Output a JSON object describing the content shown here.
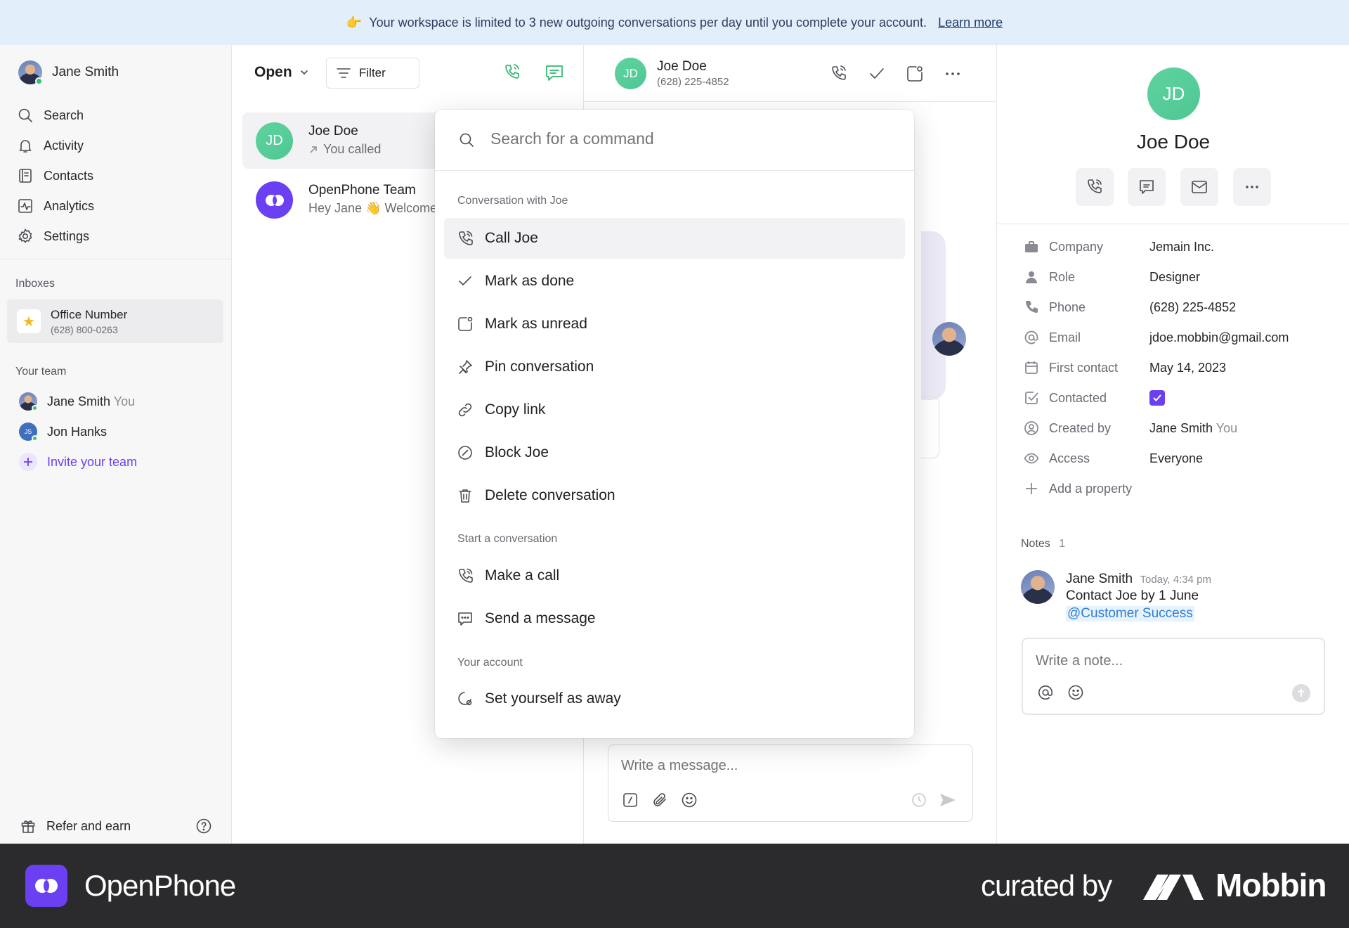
{
  "banner": {
    "emoji": "👉",
    "text": "Your workspace is limited to 3 new outgoing conversations per day until you complete your account.",
    "link": "Learn more"
  },
  "sidebar": {
    "user_name": "Jane Smith",
    "nav": [
      "Search",
      "Activity",
      "Contacts",
      "Analytics",
      "Settings"
    ],
    "inboxes_label": "Inboxes",
    "inbox": {
      "name": "Office Number",
      "number": "(628) 800-0263"
    },
    "team_label": "Your team",
    "team": [
      {
        "name": "Jane Smith",
        "tag": "You"
      },
      {
        "name": "Jon Hanks",
        "tag": "",
        "initials": "JS"
      }
    ],
    "invite": "Invite your team",
    "refer": "Refer and earn"
  },
  "list": {
    "status": "Open",
    "filter": "Filter",
    "items": [
      {
        "initials": "JD",
        "name": "Joe Doe",
        "preview": "You called"
      },
      {
        "name": "OpenPhone Team",
        "preview": "Hey Jane 👋 Welcome"
      }
    ]
  },
  "chat": {
    "initials": "JD",
    "name": "Joe Doe",
    "phone": "(628) 225-4852",
    "composer_placeholder": "Write a message..."
  },
  "palette": {
    "search_placeholder": "Search for a command",
    "section1": "Conversation with Joe",
    "items1": [
      "Call Joe",
      "Mark as done",
      "Mark as unread",
      "Pin conversation",
      "Copy link",
      "Block Joe",
      "Delete conversation"
    ],
    "section2": "Start a conversation",
    "items2": [
      "Make a call",
      "Send a message"
    ],
    "section3": "Your account",
    "items3": [
      "Set yourself as away"
    ]
  },
  "contact": {
    "initials": "JD",
    "name": "Joe Doe",
    "props": [
      {
        "label": "Company",
        "value": "Jemain Inc.",
        "icon": "briefcase-icon"
      },
      {
        "label": "Role",
        "value": "Designer",
        "icon": "person-icon"
      },
      {
        "label": "Phone",
        "value": "(628) 225-4852",
        "icon": "phone-icon"
      },
      {
        "label": "Email",
        "value": "jdoe.mobbin@gmail.com",
        "icon": "at-icon"
      },
      {
        "label": "First contact",
        "value": "May 14, 2023",
        "icon": "calendar-icon"
      },
      {
        "label": "Contacted",
        "value": "",
        "icon": "checkbox-icon"
      },
      {
        "label": "Created by",
        "value": "Jane Smith",
        "icon": "user-circle-icon"
      },
      {
        "label": "Access",
        "value": "Everyone",
        "icon": "eye-icon"
      }
    ],
    "created_by_tag": "You",
    "add_property": "Add a property",
    "notes_label": "Notes",
    "notes_count": "1",
    "note": {
      "author": "Jane Smith",
      "time": "Today, 4:34 pm",
      "text": "Contact Joe by 1 June",
      "mention": "@Customer Success"
    },
    "note_placeholder": "Write a note..."
  },
  "footer": {
    "brand": "OpenPhone",
    "curated": "curated by",
    "mobbin": "Mobbin"
  },
  "colors": {
    "accent": "#6b3ff2",
    "green": "#47c48d",
    "banner": "#e3eefb"
  }
}
